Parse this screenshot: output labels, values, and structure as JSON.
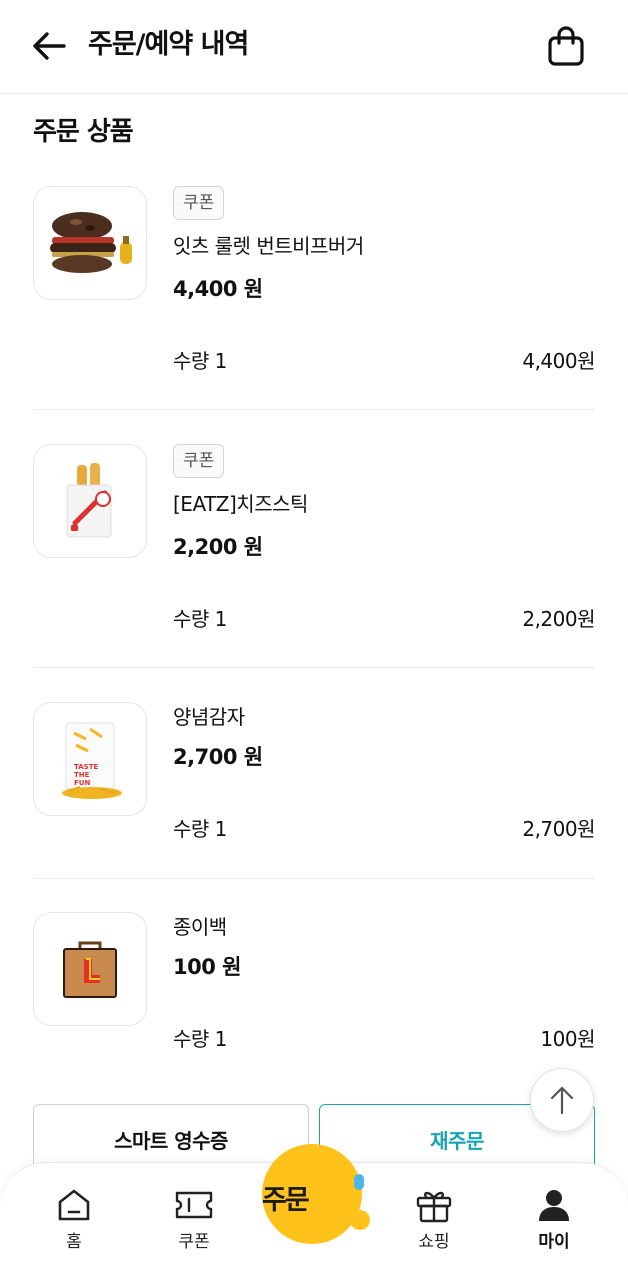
{
  "header": {
    "title": "주문/예약 내역",
    "back_icon": "arrow-left-icon",
    "cart_icon": "shopping-bag-icon"
  },
  "section": {
    "title": "주문 상품"
  },
  "items": [
    {
      "badge": "쿠폰",
      "name": "잇츠 룰렛 번트비프버거",
      "price": "4,400 원",
      "qty": "수량 1",
      "total": "4,400원",
      "image": "burger"
    },
    {
      "badge": "쿠폰",
      "name": "[EATZ]치즈스틱",
      "price": "2,200 원",
      "qty": "수량 1",
      "total": "2,200원",
      "image": "cheese-stick"
    },
    {
      "badge": "",
      "name": "양념감자",
      "price": "2,700 원",
      "qty": "수량 1",
      "total": "2,700원",
      "image": "fries"
    },
    {
      "badge": "",
      "name": "종이백",
      "price": "100 원",
      "qty": "수량 1",
      "total": "100원",
      "image": "paper-bag"
    }
  ],
  "actions": {
    "receipt_label": "스마트 영수증",
    "reorder_label": "재주문"
  },
  "tabbar": {
    "home": "홈",
    "coupon": "쿠폰",
    "order": "주문",
    "shopping": "쇼핑",
    "my": "마이"
  },
  "colors": {
    "accent": "#16a5b4",
    "order_button": "#ffc21a",
    "divider": "#ebebeb"
  }
}
